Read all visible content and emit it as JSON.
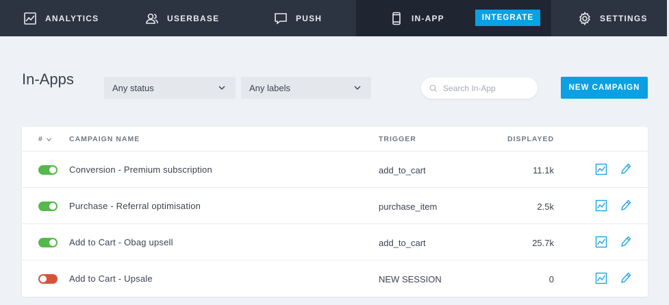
{
  "nav": {
    "analytics": "ANALYTICS",
    "userbase": "USERBASE",
    "push": "PUSH",
    "inapp": "IN-APP",
    "integrate": "INTEGRATE",
    "settings": "SETTINGS"
  },
  "header": {
    "title": "In-Apps",
    "status_filter": "Any status",
    "labels_filter": "Any labels",
    "search_placeholder": "Search In-App",
    "new_campaign": "NEW CAMPAIGN"
  },
  "table": {
    "columns": {
      "hash": "#",
      "name": "CAMPAIGN NAME",
      "trigger": "TRIGGER",
      "displayed": "DISPLAYED"
    },
    "rows": [
      {
        "active": true,
        "name": "Conversion - Premium subscription",
        "trigger": "add_to_cart",
        "displayed": "11.1k"
      },
      {
        "active": true,
        "name": "Purchase - Referral optimisation",
        "trigger": "purchase_item",
        "displayed": "2.5k"
      },
      {
        "active": true,
        "name": "Add to Cart - Obag upsell",
        "trigger": "add_to_cart",
        "displayed": "25.7k"
      },
      {
        "active": false,
        "name": "Add to Cart - Upsale",
        "trigger": "NEW SESSION",
        "displayed": "0"
      }
    ]
  },
  "colors": {
    "nav_bg": "#2c3442",
    "accent": "#0aa0e4",
    "toggle_on": "#55b84b",
    "toggle_off": "#d5533a"
  },
  "icons": {
    "analytics": "line-chart-icon",
    "userbase": "users-icon",
    "push": "chat-bubble-icon",
    "inapp": "mobile-phone-icon",
    "settings": "gear-icon",
    "search": "search-icon",
    "row_stats": "stats-chart-icon",
    "row_edit": "pencil-icon"
  }
}
